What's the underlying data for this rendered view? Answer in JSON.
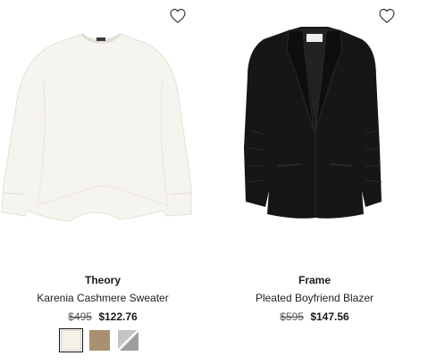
{
  "products": [
    {
      "brand": "Theory",
      "name": "Karenia Cashmere Sweater",
      "original_price": "$495",
      "sale_price": "$122.76",
      "wishlist_icon": "heart-outline-icon",
      "image": "ivory-sweater",
      "swatches": [
        {
          "color": "#f4f1e6",
          "selected": true,
          "label": "ivory"
        },
        {
          "color": "#a89070",
          "selected": false,
          "label": "camel"
        },
        {
          "color": "#b8b8b8",
          "selected": false,
          "label": "grey-pattern"
        }
      ]
    },
    {
      "brand": "Frame",
      "name": "Pleated Boyfriend Blazer",
      "original_price": "$595",
      "sale_price": "$147.56",
      "wishlist_icon": "heart-outline-icon",
      "image": "black-blazer"
    }
  ],
  "colors": {
    "text": "#1a1a1a",
    "strike": "#555555"
  }
}
